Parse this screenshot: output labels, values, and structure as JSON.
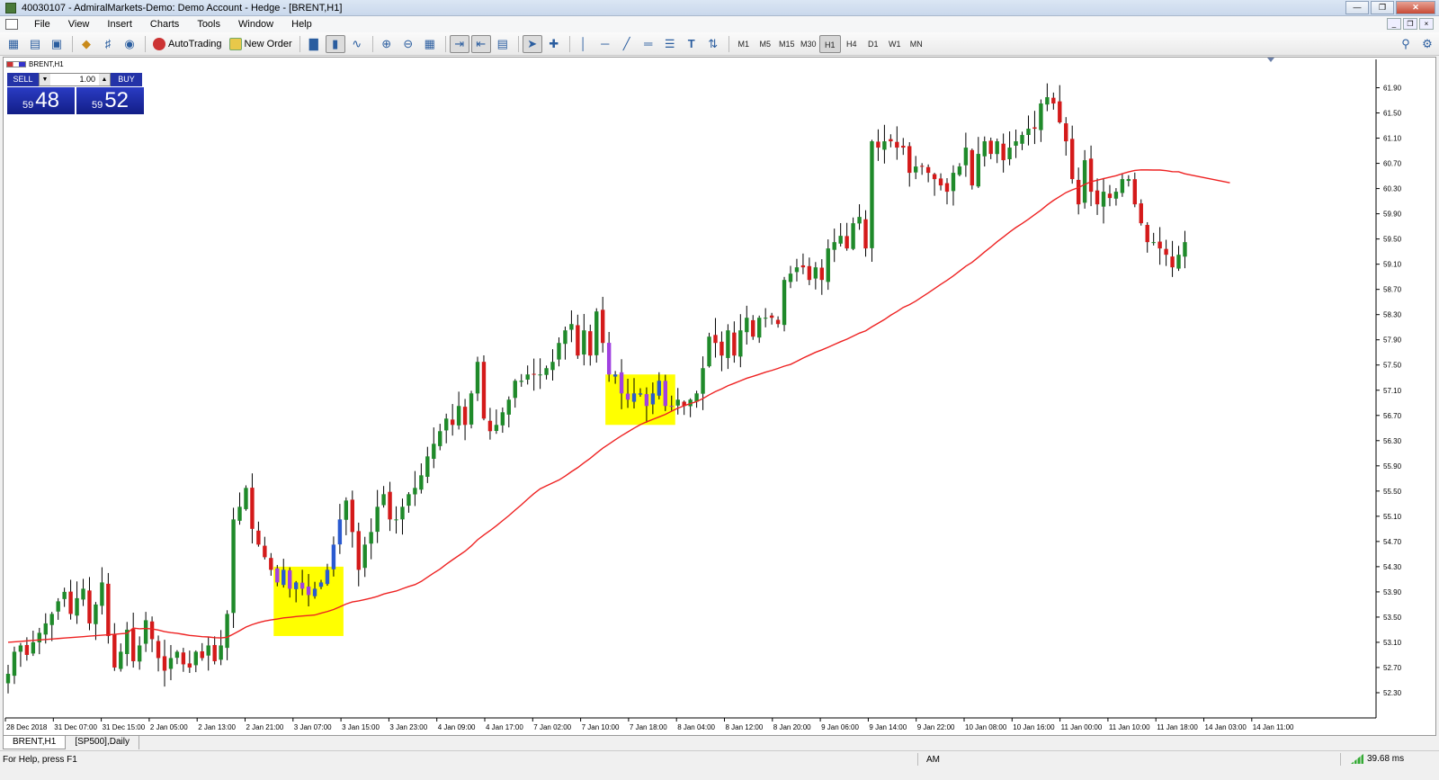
{
  "window": {
    "title": "40030107 - AdmiralMarkets-Demo: Demo Account - Hedge - [BRENT,H1]",
    "controls": [
      "minimize",
      "maximize",
      "close"
    ]
  },
  "menu": {
    "items": [
      "File",
      "View",
      "Insert",
      "Charts",
      "Tools",
      "Window",
      "Help"
    ]
  },
  "toolbar": {
    "autotrading_label": "AutoTrading",
    "new_order_label": "New Order",
    "timeframes": [
      "M1",
      "M5",
      "M15",
      "M30",
      "H1",
      "H4",
      "D1",
      "W1",
      "MN"
    ],
    "active_timeframe": "H1"
  },
  "chart": {
    "symbol_label": "BRENT,H1",
    "background": "#ffffff",
    "bull_color": "#1f8a2a",
    "bear_color": "#d41a1a",
    "ma_color": "#ee2222",
    "highlight_color": "#ffff00",
    "highlight_candle_color": "#a040e0"
  },
  "trade_panel": {
    "sell_label": "SELL",
    "buy_label": "BUY",
    "lot": "1.00",
    "sell_price_prefix": "59",
    "sell_price_big": "48",
    "buy_price_prefix": "59",
    "buy_price_big": "52"
  },
  "chart_data": {
    "type": "candlestick",
    "y_ticks": [
      "61.90",
      "61.50",
      "61.10",
      "60.70",
      "60.30",
      "59.90",
      "59.50",
      "59.10",
      "58.70",
      "58.30",
      "57.90",
      "57.50",
      "57.10",
      "56.70",
      "56.30",
      "55.90",
      "55.50",
      "55.10",
      "54.70",
      "54.30",
      "53.90",
      "53.50",
      "53.10",
      "52.70",
      "52.30"
    ],
    "ylim": [
      51.9,
      62.35
    ],
    "x_ticks": [
      "28 Dec 2018",
      "31 Dec 07:00",
      "31 Dec 15:00",
      "2 Jan 05:00",
      "2 Jan 13:00",
      "2 Jan 21:00",
      "3 Jan 07:00",
      "3 Jan 15:00",
      "3 Jan 23:00",
      "4 Jan 09:00",
      "4 Jan 17:00",
      "7 Jan 02:00",
      "7 Jan 10:00",
      "7 Jan 18:00",
      "8 Jan 04:00",
      "8 Jan 12:00",
      "8 Jan 20:00",
      "9 Jan 06:00",
      "9 Jan 14:00",
      "9 Jan 22:00",
      "10 Jan 08:00",
      "10 Jan 16:00",
      "11 Jan 00:00",
      "11 Jan 10:00",
      "11 Jan 18:00",
      "14 Jan 03:00",
      "14 Jan 11:00"
    ],
    "close_prices": [
      52.6,
      52.95,
      53.05,
      52.9,
      53.1,
      53.25,
      53.4,
      53.55,
      53.75,
      53.9,
      53.55,
      53.8,
      53.95,
      53.4,
      53.7,
      54.05,
      53.2,
      52.7,
      52.95,
      53.3,
      52.8,
      53.05,
      53.45,
      53.15,
      52.85,
      52.65,
      52.85,
      52.95,
      52.75,
      52.7,
      52.95,
      52.85,
      53.05,
      52.8,
      53.05,
      53.55,
      55.05,
      55.25,
      55.55,
      54.9,
      54.65,
      54.45,
      54.25,
      54.05,
      54.25,
      53.95,
      54.05,
      53.95,
      53.85,
      53.95,
      54.05,
      54.25,
      54.65,
      55.05,
      55.35,
      54.85,
      54.25,
      54.65,
      54.85,
      55.25,
      55.45,
      55.05,
      55.05,
      55.25,
      55.45,
      55.55,
      55.75,
      56.05,
      56.25,
      56.45,
      56.65,
      56.55,
      56.85,
      56.55,
      57.05,
      57.55,
      56.65,
      56.45,
      56.55,
      56.75,
      56.95,
      57.25,
      57.25,
      57.35,
      57.35,
      57.35,
      57.45,
      57.55,
      57.85,
      58.05,
      58.15,
      57.65,
      58.05,
      57.65,
      58.35,
      57.85,
      57.35,
      57.35,
      57.05,
      56.95,
      57.05,
      57.05,
      56.85,
      57.05,
      57.25,
      56.85,
      56.85,
      56.95,
      56.85,
      56.95,
      57.05,
      57.45,
      57.95,
      57.85,
      57.65,
      58.05,
      57.65,
      58.05,
      58.25,
      57.95,
      58.25,
      58.25,
      58.25,
      58.15,
      58.85,
      58.95,
      59.05,
      59.05,
      58.85,
      59.05,
      58.85,
      59.35,
      59.45,
      59.55,
      59.35,
      59.75,
      59.85,
      59.35,
      61.05,
      60.95,
      61.05,
      61.05,
      60.95,
      60.95,
      60.55,
      60.65,
      60.65,
      60.55,
      60.45,
      60.35,
      60.25,
      60.55,
      60.65,
      60.95,
      60.35,
      60.85,
      61.05,
      60.85,
      61.05,
      60.75,
      60.95,
      61.05,
      61.15,
      61.25,
      61.25,
      61.65,
      61.75,
      61.65,
      61.35,
      61.05,
      60.45,
      60.05,
      60.75,
      60.25,
      60.05,
      60.25,
      60.15,
      60.25,
      60.45,
      60.45,
      60.05,
      59.75,
      59.45,
      59.45,
      59.35,
      59.25,
      59.05,
      59.25,
      59.45
    ],
    "ma_period_note": "",
    "highlight_zones": [
      {
        "start_index": 43,
        "end_index": 53,
        "y_low": 53.2,
        "y_high": 54.3
      },
      {
        "start_index": 96,
        "end_index": 106,
        "y_low": 56.55,
        "y_high": 57.35
      }
    ]
  },
  "tabs": {
    "items": [
      "BRENT,H1",
      "[SP500],Daily"
    ],
    "active": "BRENT,H1"
  },
  "status": {
    "help_text": "For Help, press F1",
    "ampm": "AM",
    "ping": "39.68 ms"
  }
}
